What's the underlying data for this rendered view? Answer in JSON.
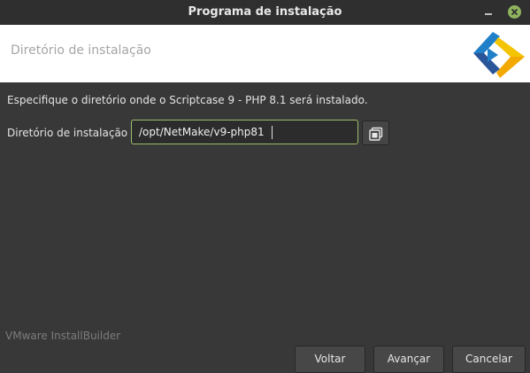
{
  "window": {
    "title": "Programa de instalação",
    "minimize_icon": "minimize-icon",
    "close_icon": "close-icon"
  },
  "header": {
    "title": "Diretório de instalação",
    "logo_icon": "scriptcase-logo",
    "logo_colors": [
      "#1f7fc9",
      "#f5c400",
      "#2a5599"
    ]
  },
  "main": {
    "description": "Especifique o diretório onde o Scriptcase 9 - PHP 8.1 será instalado.",
    "directory_label": "Diretório de instalação",
    "directory_value": "/opt/NetMake/v9-php81",
    "browse_icon": "folder-browse-icon"
  },
  "footer": {
    "brand": "VMware InstallBuilder",
    "back_label": "Voltar",
    "next_label": "Avançar",
    "cancel_label": "Cancelar"
  },
  "colors": {
    "background": "#383838",
    "titlebar": "#2f2f2f",
    "accent": "#9bbd6c",
    "close_button": "#8fb35f"
  }
}
